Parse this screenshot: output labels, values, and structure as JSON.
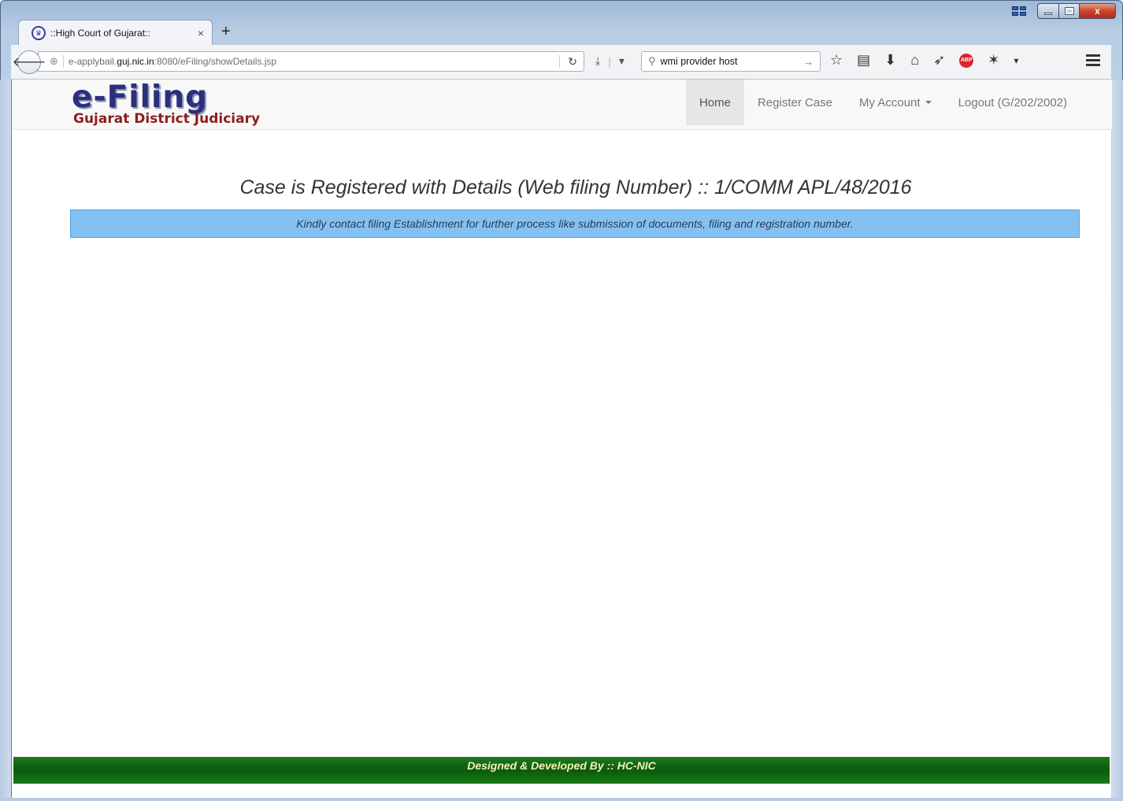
{
  "browser": {
    "tab": {
      "title": "::High Court of Gujarat::",
      "close": "×"
    },
    "new_tab": "+",
    "url": {
      "prefix": "e-applybail.",
      "host": "guj.nic.in",
      "suffix": ":8080/eFiling/showDetails.jsp"
    },
    "search": {
      "value": "wmi provider host"
    }
  },
  "site": {
    "logo": {
      "title": "e-Filing",
      "subtitle": "Gujarat District Judiciary"
    },
    "nav": {
      "home": "Home",
      "register_case": "Register Case",
      "my_account": "My Account",
      "logout": "Logout (G/202/2002)"
    },
    "heading": "Case is Registered with Details (Web filing Number) :: 1/COMM APL/48/2016",
    "notice": "Kindly contact filing Establishment for further process like submission of documents, filing and registration number.",
    "footer": "Designed & Developed By :: HC-NIC"
  },
  "colors": {
    "notice_bg": "#84c1f3",
    "footer_bg": "#0b5a0b",
    "logo_blue": "#2b2f7e",
    "logo_red": "#8f1d1d"
  }
}
